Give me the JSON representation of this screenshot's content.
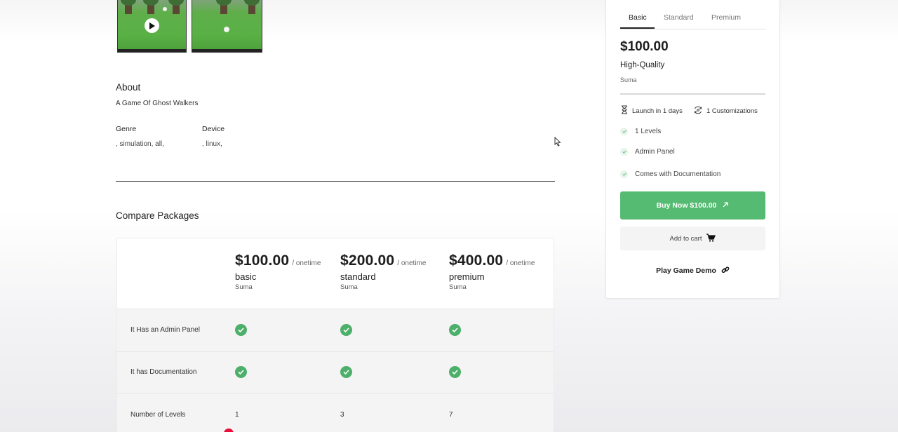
{
  "media": {
    "thumbnails": [
      {
        "kind": "video",
        "icon": "play-icon"
      },
      {
        "kind": "image"
      }
    ]
  },
  "about": {
    "title": "About",
    "description": "A Game Of Ghost Walkers",
    "genre_label": "Genre",
    "genre_value": ", simulation, all,",
    "device_label": "Device",
    "device_value": ", linux,"
  },
  "compare": {
    "title": "Compare Packages",
    "packages": [
      {
        "price": "$100.00",
        "period": "/ onetime",
        "name": "basic",
        "seller": "Suma"
      },
      {
        "price": "$200.00",
        "period": "/ onetime",
        "name": "standard",
        "seller": "Suma"
      },
      {
        "price": "$400.00",
        "period": "/ onetime",
        "name": "premium",
        "seller": "Suma"
      }
    ],
    "rows": [
      {
        "label": "It Has an Admin Panel",
        "values": [
          true,
          true,
          true
        ]
      },
      {
        "label": "It has Documentation",
        "values": [
          true,
          true,
          true
        ]
      },
      {
        "label": "Number of Levels",
        "values": [
          "1",
          "3",
          "7"
        ]
      }
    ]
  },
  "card": {
    "tabs": [
      "Basic",
      "Standard",
      "Premium"
    ],
    "active_tab": "Basic",
    "price": "$100.00",
    "quality": "High-Quality",
    "seller": "Suma",
    "launch": "Launch in 1 days",
    "customizations": "1 Customizations",
    "features": [
      "1 Levels",
      "Admin Panel",
      "Comes with Documentation"
    ],
    "buy_label": "Buy Now $100.00",
    "cart_label": "Add to cart",
    "demo_label": "Play Game Demo"
  },
  "colors": {
    "accent_green": "#56bb72",
    "check_green": "#4caf6a",
    "record_red": "#e8103a"
  }
}
